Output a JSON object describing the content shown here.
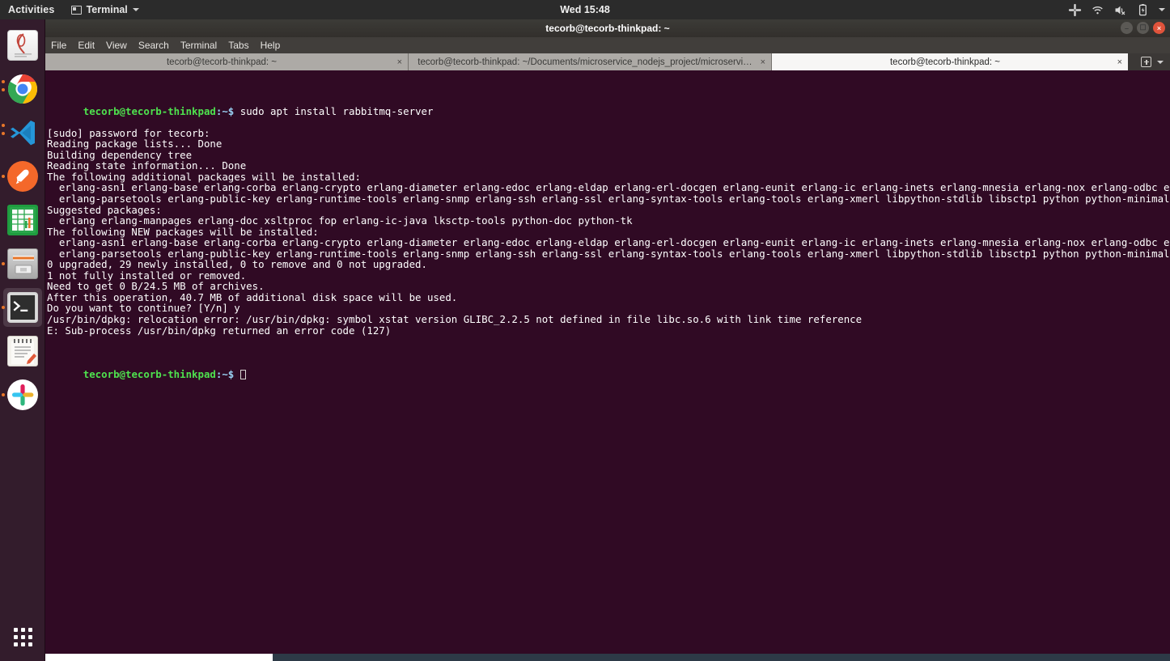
{
  "topbar": {
    "activities": "Activities",
    "app_menu": "Terminal",
    "app_menu_icon": "window-icon",
    "dropdown_icon": "chevron-down-icon",
    "clock": "Wed 15:48",
    "tray_icons": [
      "slack-icon",
      "wifi-icon",
      "volume-muted-icon",
      "battery-icon",
      "chevron-down-icon"
    ]
  },
  "dock": {
    "items": [
      {
        "name": "pdf-reader",
        "running": false
      },
      {
        "name": "google-chrome",
        "running": true
      },
      {
        "name": "visual-studio-code",
        "running": true
      },
      {
        "name": "postman",
        "running": true
      },
      {
        "name": "libreoffice-calc",
        "running": false
      },
      {
        "name": "files",
        "running": true
      },
      {
        "name": "terminal",
        "running": true,
        "active": true
      },
      {
        "name": "text-editor",
        "running": false
      },
      {
        "name": "slack",
        "running": true
      }
    ],
    "show_applications": "show-applications-icon"
  },
  "window": {
    "title": "tecorb@tecorb-thinkpad: ~",
    "controls": {
      "minimize": "–",
      "maximize": "☐",
      "close": "×"
    },
    "menu": [
      "File",
      "Edit",
      "View",
      "Search",
      "Terminal",
      "Tabs",
      "Help"
    ],
    "tabs": [
      {
        "label": "tecorb@tecorb-thinkpad: ~",
        "close": "×",
        "active": false
      },
      {
        "label": "tecorb@tecorb-thinkpad: ~/Documents/microservice_nodejs_project/microservi…",
        "close": "×",
        "active": false
      },
      {
        "label": "tecorb@tecorb-thinkpad: ~",
        "close": "×",
        "active": true
      }
    ],
    "new_tab_icon": "new-tab-icon",
    "tab_list_icon": "chevron-down-icon"
  },
  "terminal": {
    "colors": {
      "background": "#300a24",
      "foreground": "#ffffff",
      "prompt_user": "#4ee24e",
      "prompt_path": "#9ad2f5"
    },
    "prompt_user": "tecorb@tecorb-thinkpad",
    "prompt_path": ":~$",
    "command": " sudo apt install rabbitmq-server",
    "output": [
      "[sudo] password for tecorb:",
      "Reading package lists... Done",
      "Building dependency tree",
      "Reading state information... Done",
      "The following additional packages will be installed:",
      "  erlang-asn1 erlang-base erlang-corba erlang-crypto erlang-diameter erlang-edoc erlang-eldap erlang-erl-docgen erlang-eunit erlang-ic erlang-inets erlang-mnesia erlang-nox erlang-odbc erlang-os-mon",
      "  erlang-parsetools erlang-public-key erlang-runtime-tools erlang-snmp erlang-ssh erlang-ssl erlang-syntax-tools erlang-tools erlang-xmerl libpython-stdlib libsctp1 python python-minimal",
      "Suggested packages:",
      "  erlang erlang-manpages erlang-doc xsltproc fop erlang-ic-java lksctp-tools python-doc python-tk",
      "The following NEW packages will be installed:",
      "  erlang-asn1 erlang-base erlang-corba erlang-crypto erlang-diameter erlang-edoc erlang-eldap erlang-erl-docgen erlang-eunit erlang-ic erlang-inets erlang-mnesia erlang-nox erlang-odbc erlang-os-mon",
      "  erlang-parsetools erlang-public-key erlang-runtime-tools erlang-snmp erlang-ssh erlang-ssl erlang-syntax-tools erlang-tools erlang-xmerl libpython-stdlib libsctp1 python python-minimal rabbitmq-server",
      "0 upgraded, 29 newly installed, 0 to remove and 0 not upgraded.",
      "1 not fully installed or removed.",
      "Need to get 0 B/24.5 MB of archives.",
      "After this operation, 40.7 MB of additional disk space will be used.",
      "Do you want to continue? [Y/n] y",
      "/usr/bin/dpkg: relocation error: /usr/bin/dpkg: symbol xstat version GLIBC_2.2.5 not defined in file libc.so.6 with link time reference",
      "E: Sub-process /usr/bin/dpkg returned an error code (127)"
    ]
  }
}
